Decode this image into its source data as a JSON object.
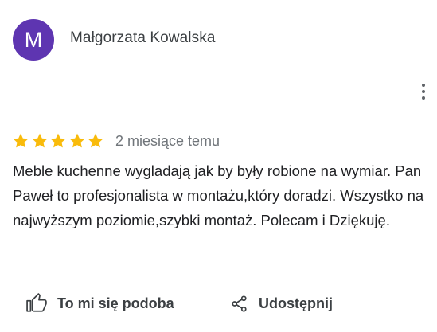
{
  "review": {
    "author": {
      "initial": "M",
      "name": "Małgorzata Kowalska",
      "avatar_color": "#5e35b1"
    },
    "rating": 5,
    "rating_max": 5,
    "star_color": "#f9bb0b",
    "time_ago": "2 miesiące temu",
    "text": "Meble kuchenne wygladają jak by były robione na wymiar. Pan Paweł to profesjonalista w montażu,który doradzi. Wszystko na najwyższym poziomie,szybki montaż. Polecam i Dziękuję."
  },
  "actions": {
    "like_label": "To mi się podoba",
    "like_icon": "thumb-up-outline-icon",
    "share_label": "Udostępnij",
    "share_icon": "share-icon",
    "more_icon": "more-vert-icon"
  }
}
